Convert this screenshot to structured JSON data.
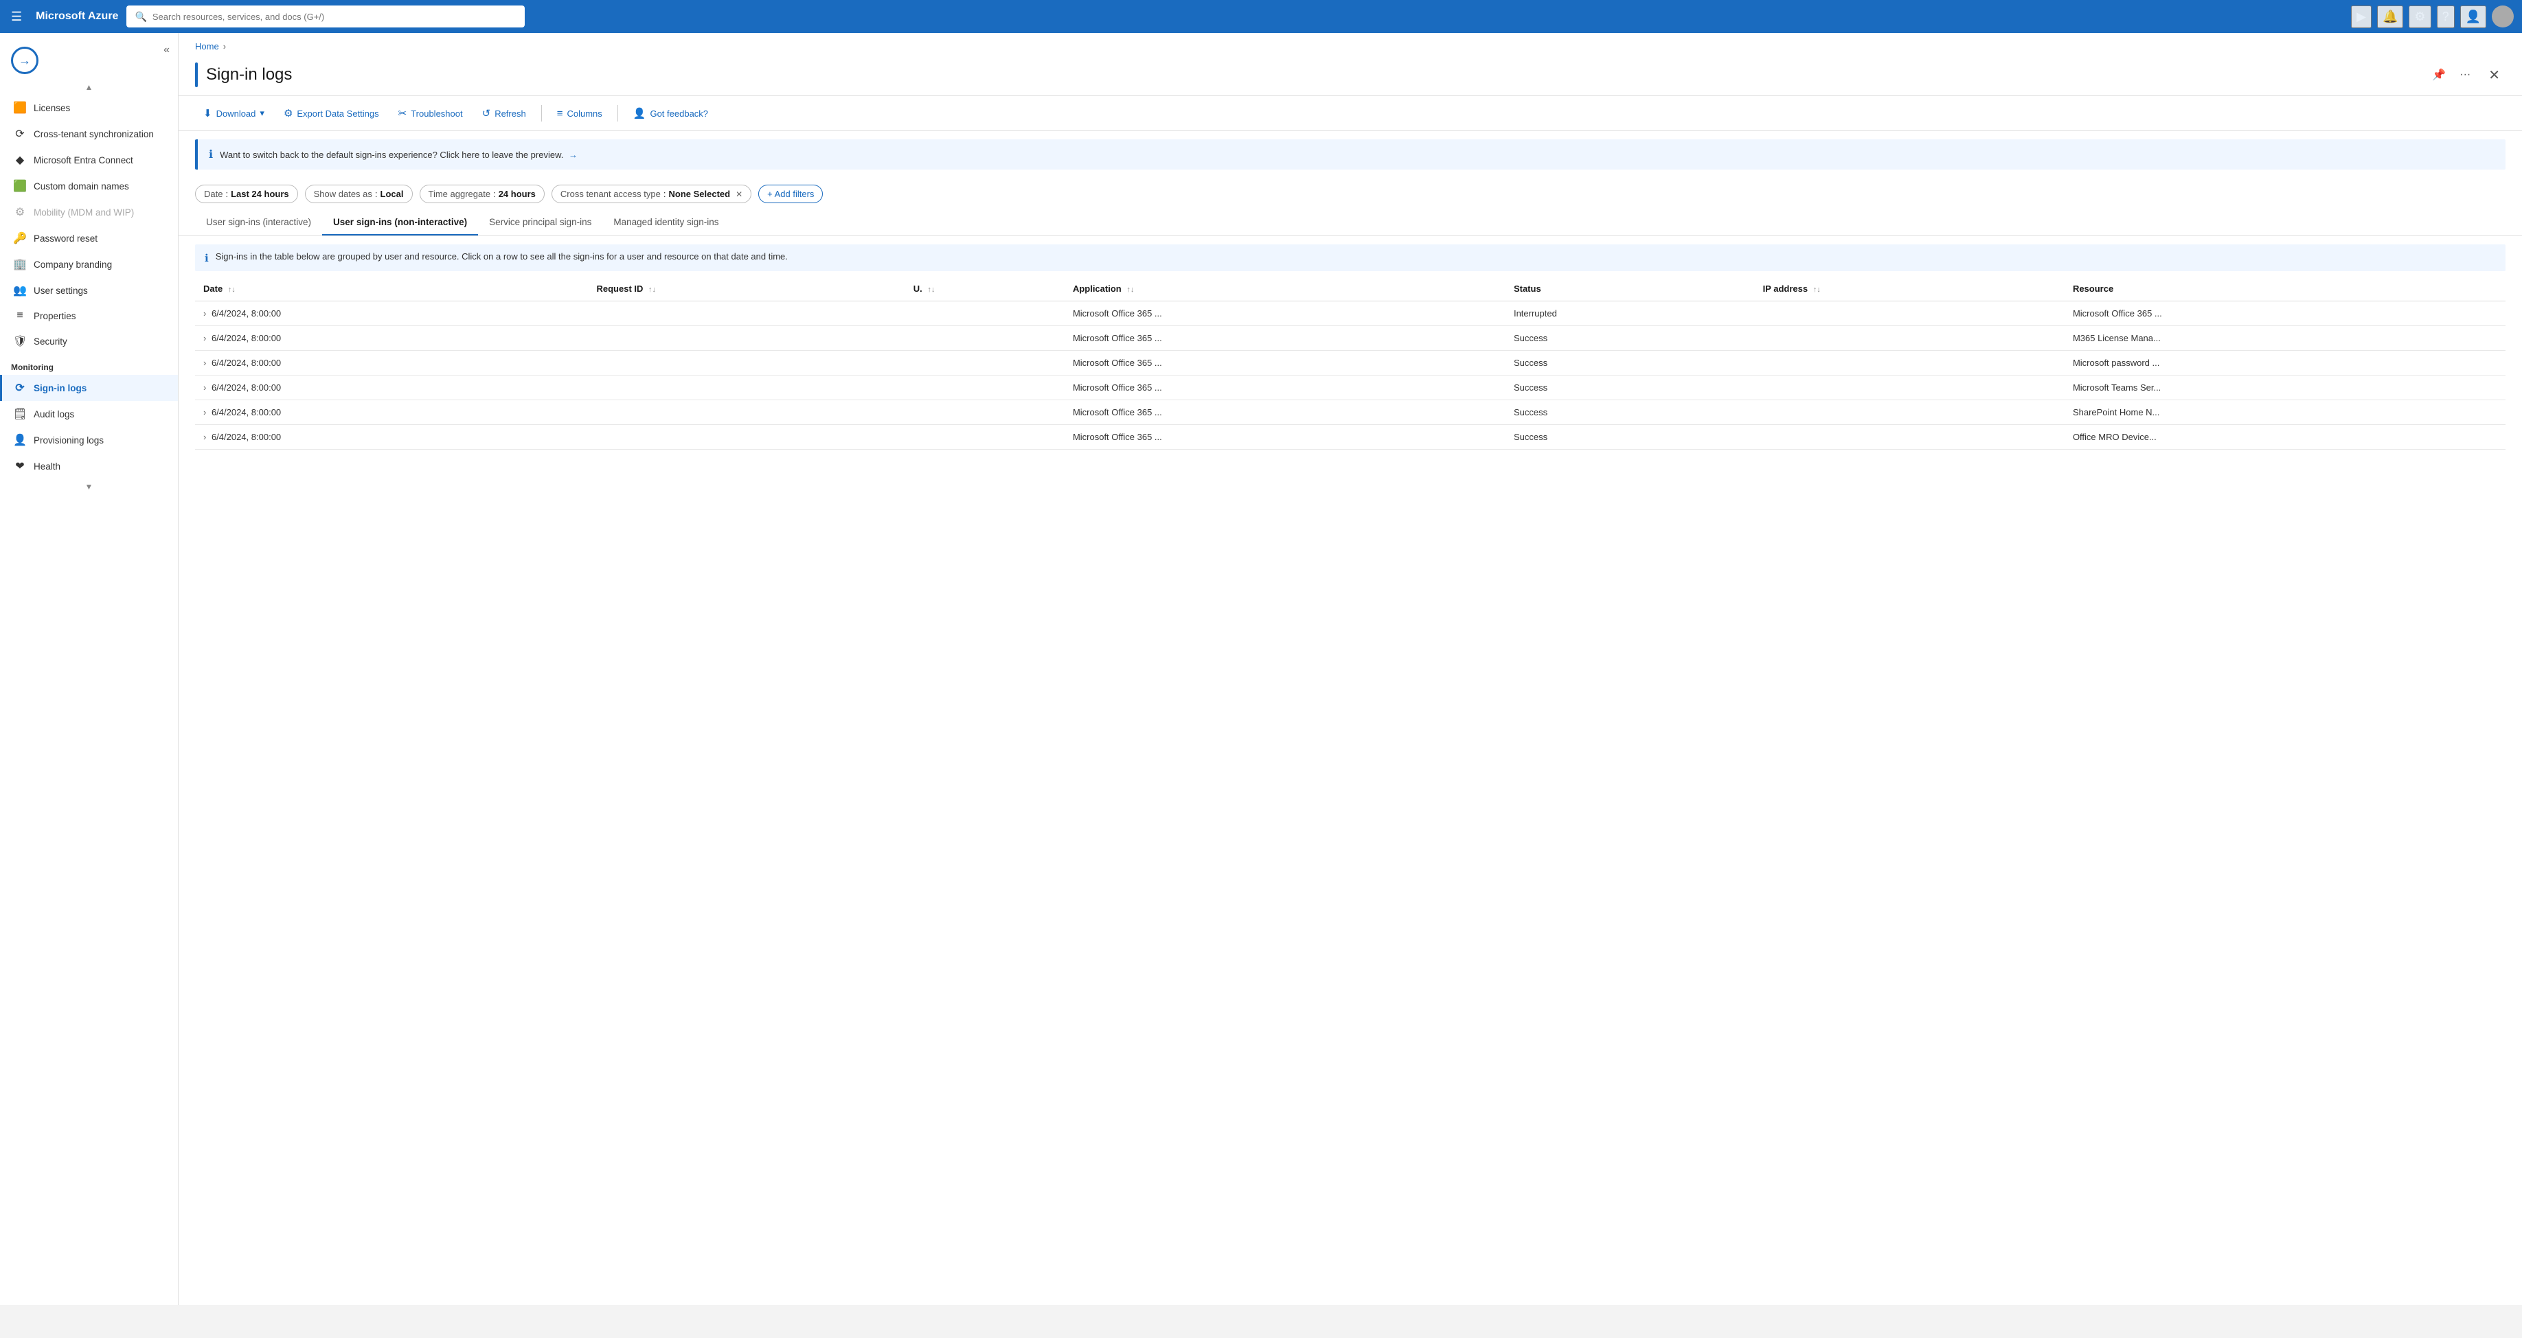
{
  "topnav": {
    "hamburger_label": "☰",
    "app_title": "Microsoft Azure",
    "search_placeholder": "Search resources, services, and docs (G+/)",
    "icons": [
      "▶",
      "🔔",
      "⚙",
      "?",
      "👤"
    ]
  },
  "breadcrumb": {
    "items": [
      "Home"
    ]
  },
  "page": {
    "title": "Sign-in logs",
    "pin_label": "📌",
    "more_label": "···",
    "close_label": "✕"
  },
  "toolbar": {
    "download_label": "Download",
    "export_label": "Export Data Settings",
    "troubleshoot_label": "Troubleshoot",
    "refresh_label": "Refresh",
    "columns_label": "Columns",
    "feedback_label": "Got feedback?"
  },
  "info_banner": {
    "text": "Want to switch back to the default sign-ins experience? Click here to leave the preview.",
    "arrow": "→"
  },
  "filters": {
    "date_label": "Date",
    "date_value": "Last 24 hours",
    "show_dates_label": "Show dates as",
    "show_dates_value": "Local",
    "time_agg_label": "Time aggregate",
    "time_agg_value": "24 hours",
    "cross_tenant_label": "Cross tenant access type",
    "cross_tenant_value": "None Selected",
    "add_filters_label": "+ Add filters"
  },
  "tabs": [
    {
      "id": "interactive",
      "label": "User sign-ins (interactive)",
      "active": false
    },
    {
      "id": "non-interactive",
      "label": "User sign-ins (non-interactive)",
      "active": true
    },
    {
      "id": "service-principal",
      "label": "Service principal sign-ins",
      "active": false
    },
    {
      "id": "managed-identity",
      "label": "Managed identity sign-ins",
      "active": false
    }
  ],
  "table_info": "Sign-ins in the table below are grouped by user and resource. Click on a row to see all the sign-ins for a user and resource on that date and time.",
  "table": {
    "headers": [
      {
        "id": "date",
        "label": "Date",
        "sortable": true
      },
      {
        "id": "request_id",
        "label": "Request ID",
        "sortable": true
      },
      {
        "id": "user",
        "label": "U.",
        "sortable": true
      },
      {
        "id": "application",
        "label": "Application",
        "sortable": true
      },
      {
        "id": "status",
        "label": "Status",
        "sortable": false
      },
      {
        "id": "ip_address",
        "label": "IP address",
        "sortable": true
      },
      {
        "id": "resource",
        "label": "Resource",
        "sortable": false
      }
    ],
    "rows": [
      {
        "date": "6/4/2024, 8:00:00",
        "request_id": "",
        "user": "",
        "application": "Microsoft Office 365 ...",
        "status": "Interrupted",
        "status_class": "interrupted",
        "ip_address": "",
        "resource": "Microsoft Office 365 ..."
      },
      {
        "date": "6/4/2024, 8:00:00",
        "request_id": "",
        "user": "",
        "application": "Microsoft Office 365 ...",
        "status": "Success",
        "status_class": "success",
        "ip_address": "",
        "resource": "M365 License Mana..."
      },
      {
        "date": "6/4/2024, 8:00:00",
        "request_id": "",
        "user": "",
        "application": "Microsoft Office 365 ...",
        "status": "Success",
        "status_class": "success",
        "ip_address": "",
        "resource": "Microsoft password ..."
      },
      {
        "date": "6/4/2024, 8:00:00",
        "request_id": "",
        "user": "",
        "application": "Microsoft Office 365 ...",
        "status": "Success",
        "status_class": "success",
        "ip_address": "",
        "resource": "Microsoft Teams Ser..."
      },
      {
        "date": "6/4/2024, 8:00:00",
        "request_id": "",
        "user": "",
        "application": "Microsoft Office 365 ...",
        "status": "Success",
        "status_class": "success",
        "ip_address": "",
        "resource": "SharePoint Home N..."
      },
      {
        "date": "6/4/2024, 8:00:00",
        "request_id": "",
        "user": "",
        "application": "Microsoft Office 365 ...",
        "status": "Success",
        "status_class": "success",
        "ip_address": "",
        "resource": "Office MRO Device..."
      }
    ]
  },
  "sidebar": {
    "items_top": [
      {
        "id": "licenses",
        "label": "Licenses",
        "icon": "🟧"
      },
      {
        "id": "cross-tenant-sync",
        "label": "Cross-tenant synchronization",
        "icon": "⟳"
      },
      {
        "id": "entra-connect",
        "label": "Microsoft Entra Connect",
        "icon": "◆"
      },
      {
        "id": "custom-domain",
        "label": "Custom domain names",
        "icon": "🟩"
      },
      {
        "id": "mobility",
        "label": "Mobility (MDM and WIP)",
        "icon": "⚙",
        "disabled": true
      },
      {
        "id": "password-reset",
        "label": "Password reset",
        "icon": "🔑"
      },
      {
        "id": "company-branding",
        "label": "Company branding",
        "icon": "🏢"
      },
      {
        "id": "user-settings",
        "label": "User settings",
        "icon": "👥"
      },
      {
        "id": "properties",
        "label": "Properties",
        "icon": "≡"
      },
      {
        "id": "security",
        "label": "Security",
        "icon": "🛡"
      }
    ],
    "monitoring_label": "Monitoring",
    "monitoring_items": [
      {
        "id": "sign-in-logs",
        "label": "Sign-in logs",
        "icon": "⟳",
        "active": true
      },
      {
        "id": "audit-logs",
        "label": "Audit logs",
        "icon": "🗒"
      },
      {
        "id": "provisioning-logs",
        "label": "Provisioning logs",
        "icon": "👤"
      },
      {
        "id": "health",
        "label": "Health",
        "icon": "❤"
      }
    ]
  }
}
